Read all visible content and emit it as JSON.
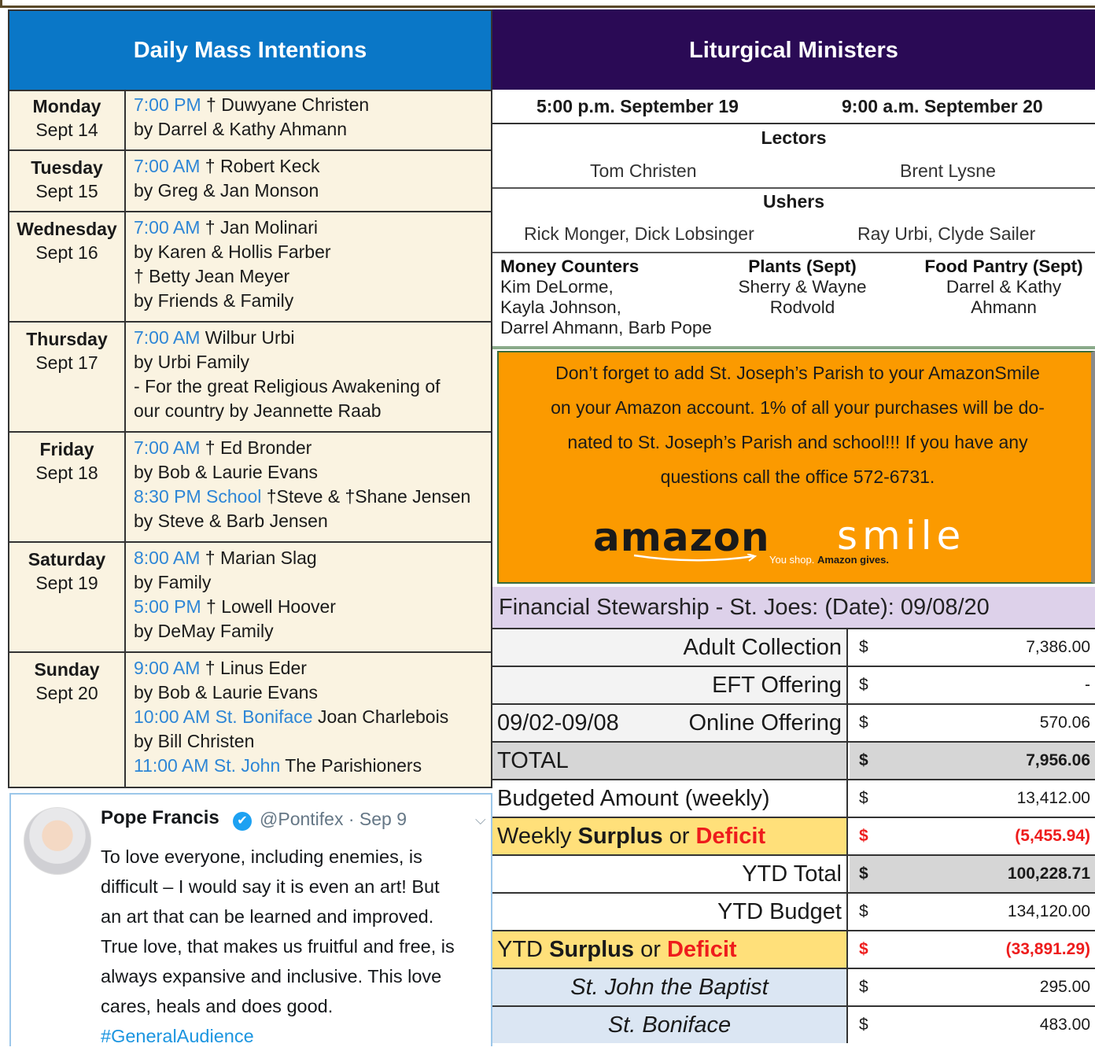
{
  "mass": {
    "title": "Daily Mass Intentions",
    "days": [
      {
        "day": "Monday",
        "date": "Sept 14",
        "lines": [
          {
            "time": "7:00 PM",
            "text": " † Duwyane Christen"
          },
          {
            "time": "",
            "text": "by Darrel & Kathy Ahmann"
          }
        ]
      },
      {
        "day": "Tuesday",
        "date": "Sept 15",
        "lines": [
          {
            "time": "7:00 AM",
            "text": " † Robert Keck"
          },
          {
            "time": "",
            "text": "by Greg & Jan Monson"
          }
        ]
      },
      {
        "day": "Wednesday",
        "date": "Sept 16",
        "lines": [
          {
            "time": "7:00 AM",
            "text": " † Jan Molinari"
          },
          {
            "time": "",
            "text": "by Karen & Hollis Farber"
          },
          {
            "time": "",
            "text": "† Betty Jean Meyer"
          },
          {
            "time": "",
            "text": "by Friends & Family"
          }
        ]
      },
      {
        "day": "Thursday",
        "date": "Sept 17",
        "lines": [
          {
            "time": "7:00 AM",
            "text": " Wilbur Urbi"
          },
          {
            "time": "",
            "text": "by Urbi Family"
          },
          {
            "time": "",
            "text": "- For the great Religious Awakening of"
          },
          {
            "time": "",
            "text": "our country by Jeannette Raab"
          }
        ]
      },
      {
        "day": "Friday",
        "date": "Sept 18",
        "lines": [
          {
            "time": "7:00 AM",
            "text": " † Ed Bronder"
          },
          {
            "time": "",
            "text": "by Bob & Laurie Evans"
          },
          {
            "time": "8:30 PM School",
            "text": " †Steve & †Shane Jensen"
          },
          {
            "time": "",
            "text": "by Steve & Barb Jensen"
          }
        ]
      },
      {
        "day": "Saturday",
        "date": "Sept 19",
        "lines": [
          {
            "time": "8:00 AM",
            "text": " † Marian Slag"
          },
          {
            "time": "",
            "text": "by Family"
          },
          {
            "time": "5:00 PM",
            "text": " † Lowell Hoover"
          },
          {
            "time": "",
            "text": "by DeMay Family"
          }
        ]
      },
      {
        "day": "Sunday",
        "date": "Sept 20",
        "lines": [
          {
            "time": "9:00 AM",
            "text": " † Linus Eder"
          },
          {
            "time": "",
            "text": "by Bob & Laurie Evans"
          },
          {
            "time": "10:00 AM St. Boniface",
            "text": " Joan Charlebois"
          },
          {
            "time": "",
            "text": "by Bill Christen"
          },
          {
            "time": "11:00 AM St. John",
            "text": " The Parishioners"
          }
        ]
      }
    ]
  },
  "tweet": {
    "name": "Pope Francis",
    "verified_icon": "✔",
    "handle": "@Pontifex · Sep 9",
    "chevron": "⌵",
    "lines": [
      "To love everyone, including enemies, is",
      "difficult – I would say it is even an art! But",
      "an art that can be learned and improved.",
      "True love, that makes us fruitful and free, is",
      "always expansive and inclusive. This love",
      "cares, heals and does good."
    ],
    "hashtag": "#GeneralAudience"
  },
  "ministers": {
    "title": "Liturgical Ministers",
    "mass1": "5:00 p.m.  September 19",
    "mass2": "9:00 a.m.  September 20",
    "lectors_title": "Lectors",
    "lector1": "Tom Christen",
    "lector2": "Brent Lysne",
    "ushers_title": "Ushers",
    "usher1": "Rick Monger, Dick Lobsinger",
    "usher2": "Ray Urbi, Clyde Sailer",
    "money_title": "Money Counters",
    "money": [
      "Kim DeLorme,",
      "Kayla Johnson,",
      "Darrel Ahmann, Barb Pope"
    ],
    "plants_title": "Plants (Sept)",
    "plants": [
      "Sherry & Wayne",
      "Rodvold"
    ],
    "pantry_title": "Food Pantry (Sept)",
    "pantry": [
      "Darrel & Kathy",
      "Ahmann"
    ]
  },
  "amazon": {
    "lines": [
      "Don’t forget to add St. Joseph’s Parish to your AmazonSmile",
      "on your Amazon account. 1% of all your purchases will be do-",
      "nated to St. Joseph’s Parish and school!!!  If you have any",
      "questions  call the office 572-6731."
    ],
    "logo_word": "amazon",
    "logo_smile": "smile",
    "tagline_a": "You shop. ",
    "tagline_b": "Amazon gives."
  },
  "finance": {
    "title": "Financial Stewarship  - St. Joes:  (Date):   09/08/20",
    "currency": "$",
    "rows": {
      "adult": {
        "label": "Adult Collection",
        "amount": "7,386.00"
      },
      "eft": {
        "label": "EFT Offering",
        "amount": "-"
      },
      "online": {
        "prefix": "09/02-09/08",
        "label": "Online Offering",
        "amount": "570.06"
      },
      "total": {
        "label": "TOTAL",
        "amount": "7,956.06"
      },
      "budget": {
        "label": "Budgeted Amount (weekly)",
        "amount": "13,412.00"
      },
      "weekly": {
        "pre": "Weekly ",
        "surplus": "Surplus",
        "or": " or ",
        "deficit": "Deficit",
        "amount": "(5,455.94)"
      },
      "ytd_total": {
        "label": "YTD Total",
        "amount": "100,228.71"
      },
      "ytd_budget": {
        "label": "YTD Budget",
        "amount": "134,120.00"
      },
      "ytd_sd": {
        "pre": "YTD ",
        "surplus": "Surplus",
        "or": " or ",
        "deficit": "Deficit",
        "amount": "(33,891.29)"
      },
      "john": {
        "label": "St. John the Baptist",
        "amount": "295.00"
      },
      "boniface": {
        "label": "St. Boniface",
        "amount": "483.00"
      }
    },
    "colors": {
      "deficit": "#ee1c1c",
      "highlight": "#ffe07a",
      "gray": "#d6d6d6",
      "blue": "#dbe6f3"
    }
  }
}
